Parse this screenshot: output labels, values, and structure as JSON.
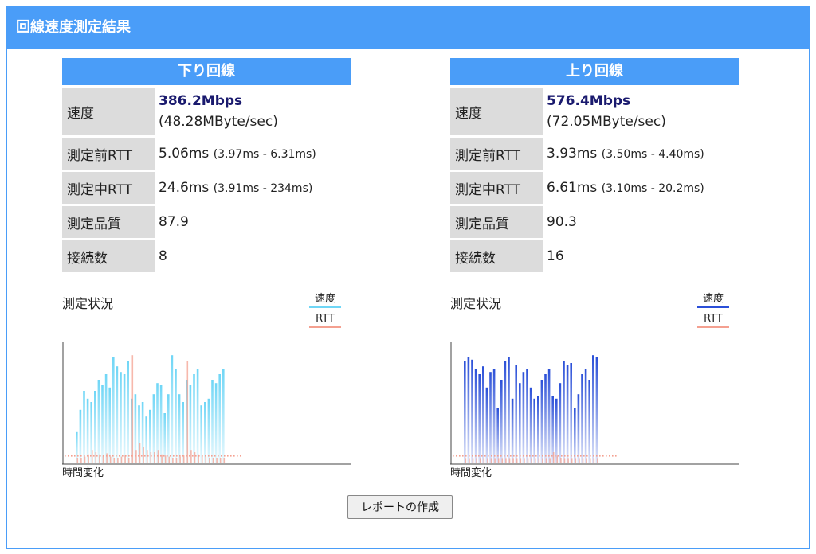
{
  "header": {
    "title": "回線速度測定結果"
  },
  "down": {
    "title": "下り回線",
    "speed_label": "速度",
    "speed_main": "386.2Mbps",
    "speed_sub": "(48.28MByte/sec)",
    "rtt_before_label": "測定前RTT",
    "rtt_before": "5.06ms",
    "rtt_before_range": "(3.97ms - 6.31ms)",
    "rtt_during_label": "測定中RTT",
    "rtt_during": "24.6ms",
    "rtt_during_range": "(3.91ms - 234ms)",
    "quality_label": "測定品質",
    "quality": "87.9",
    "connections_label": "接続数",
    "connections": "8",
    "chart_title": "測定状況",
    "legend_speed": "速度",
    "legend_rtt": "RTT",
    "chart_xlabel": "時間変化",
    "color": "#6fd6f6",
    "rtt_color": "#f4a090"
  },
  "up": {
    "title": "上り回線",
    "speed_label": "速度",
    "speed_main": "576.4Mbps",
    "speed_sub": "(72.05MByte/sec)",
    "rtt_before_label": "測定前RTT",
    "rtt_before": "3.93ms",
    "rtt_before_range": "(3.50ms - 4.40ms)",
    "rtt_during_label": "測定中RTT",
    "rtt_during": "6.61ms",
    "rtt_during_range": "(3.10ms - 20.2ms)",
    "quality_label": "測定品質",
    "quality": "90.3",
    "connections_label": "接続数",
    "connections": "16",
    "chart_title": "測定状況",
    "legend_speed": "速度",
    "legend_rtt": "RTT",
    "chart_xlabel": "時間変化",
    "color": "#2a4fd8",
    "rtt_color": "#f4a090"
  },
  "report_button": "レポートの作成",
  "chart_data": [
    {
      "type": "bar",
      "series": [
        {
          "name": "速度",
          "values": [
            0.28,
            0.48,
            0.65,
            0.58,
            0.55,
            0.65,
            0.75,
            0.7,
            0.8,
            0.68,
            0.95,
            0.87,
            0.82,
            0.8,
            0.92,
            0.58,
            0.62,
            0.52,
            0.55,
            0.42,
            0.48,
            0.62,
            0.72,
            0.7,
            0.45,
            0.62,
            0.97,
            0.85,
            0.62,
            0.55,
            0.75,
            0.7,
            0.8,
            0.85,
            0.52,
            0.55,
            0.58,
            0.75,
            0.72,
            0.8,
            0.85
          ]
        },
        {
          "name": "RTT",
          "values": [
            0.05,
            0.05,
            0.06,
            0.08,
            0.12,
            0.1,
            0.08,
            0.07,
            0.09,
            0.06,
            0.05,
            0.05,
            0.06,
            0.07,
            0.05,
            0.97,
            0.12,
            0.18,
            0.15,
            0.12,
            0.1,
            0.1,
            0.12,
            0.08,
            0.07,
            0.06,
            0.05,
            0.05,
            0.06,
            0.07,
            0.92,
            0.12,
            0.1,
            0.08,
            0.07,
            0.06,
            0.05,
            0.05,
            0.05,
            0.05,
            0.05
          ]
        }
      ]
    },
    {
      "type": "bar",
      "series": [
        {
          "name": "速度",
          "values": [
            0.92,
            0.95,
            0.93,
            0.85,
            0.8,
            0.87,
            0.68,
            0.82,
            0.85,
            0.5,
            0.75,
            0.92,
            0.95,
            0.58,
            0.88,
            0.72,
            0.82,
            0.85,
            0.68,
            0.58,
            0.6,
            0.75,
            0.8,
            0.85,
            0.6,
            0.58,
            0.72,
            0.92,
            0.88,
            0.9,
            0.5,
            0.62,
            0.8,
            0.85,
            0.75,
            0.97,
            0.95
          ]
        },
        {
          "name": "RTT",
          "values": [
            0.04,
            0.04,
            0.04,
            0.04,
            0.04,
            0.04,
            0.04,
            0.04,
            0.04,
            0.04,
            0.04,
            0.04,
            0.04,
            0.04,
            0.04,
            0.04,
            0.04,
            0.04,
            0.04,
            0.04,
            0.04,
            0.04,
            0.04,
            0.04,
            0.1,
            0.07,
            0.05,
            0.04,
            0.04,
            0.04,
            0.04,
            0.04,
            0.04,
            0.04,
            0.04,
            0.04,
            0.04
          ]
        }
      ]
    }
  ]
}
